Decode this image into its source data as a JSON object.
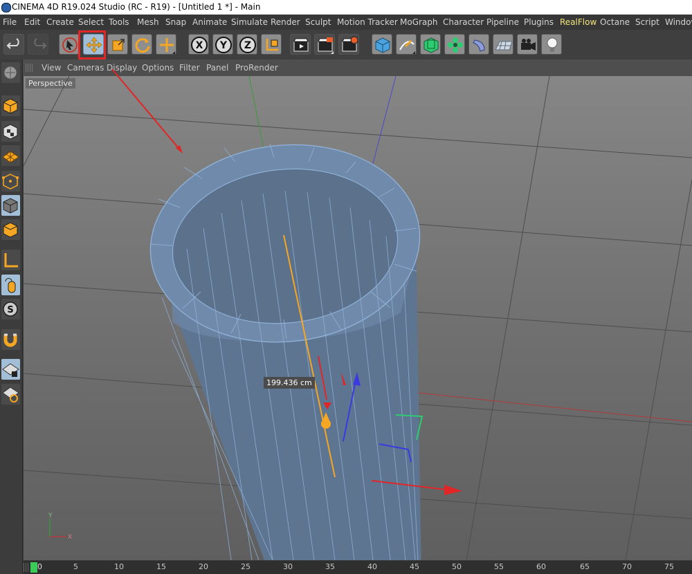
{
  "titlebar": {
    "title": "CINEMA 4D R19.024 Studio (RC - R19) - [Untitled 1 *] - Main"
  },
  "menubar": {
    "items": [
      "File",
      "Edit",
      "Create",
      "Select",
      "Tools",
      "Mesh",
      "Snap",
      "Animate",
      "Simulate",
      "Render",
      "Sculpt",
      "Motion Tracker",
      "MoGraph",
      "Character",
      "Pipeline",
      "Plugins",
      "RealFlow",
      "Octane",
      "Script",
      "Window"
    ]
  },
  "toolbar": {
    "undo_icon": "undo-icon",
    "redo_icon": "redo-icon",
    "live_select_icon": "live-selection-icon",
    "move_icon": "move-icon",
    "scale_icon": "scale-icon",
    "rotate_icon": "rotate-icon",
    "add_icon": "add-icon",
    "x_axis": "X",
    "y_axis": "Y",
    "z_axis": "Z",
    "coord_icon": "coordinate-system-icon",
    "render_view_icon": "render-view-icon",
    "render_picture_icon": "render-picture-viewer-icon",
    "render_settings_icon": "render-settings-icon",
    "cube_icon": "cube-icon",
    "pen_icon": "pen-icon",
    "subdivision_icon": "subdivision-surface-icon",
    "cloner_icon": "cloner-icon",
    "deformer_icon": "deformer-icon",
    "floor_icon": "floor-icon",
    "camera_icon": "camera-icon",
    "light_icon": "light-icon"
  },
  "viewport_menu": {
    "items": [
      "View",
      "Cameras",
      "Display",
      "Options",
      "Filter",
      "Panel",
      "ProRender"
    ]
  },
  "viewport": {
    "name": "Perspective",
    "measurement": "199.436 cm"
  },
  "timeline": {
    "start_frame": "0",
    "ticks": [
      "5",
      "10",
      "15",
      "20",
      "25",
      "30",
      "35",
      "40",
      "45",
      "50",
      "55",
      "60",
      "65",
      "70",
      "75"
    ]
  },
  "colors": {
    "accent_orange": "#f5a623",
    "highlight_red": "#e02626",
    "mesh_blue": "#5a7fa8",
    "realflow_yellow": "#f3e57c"
  }
}
